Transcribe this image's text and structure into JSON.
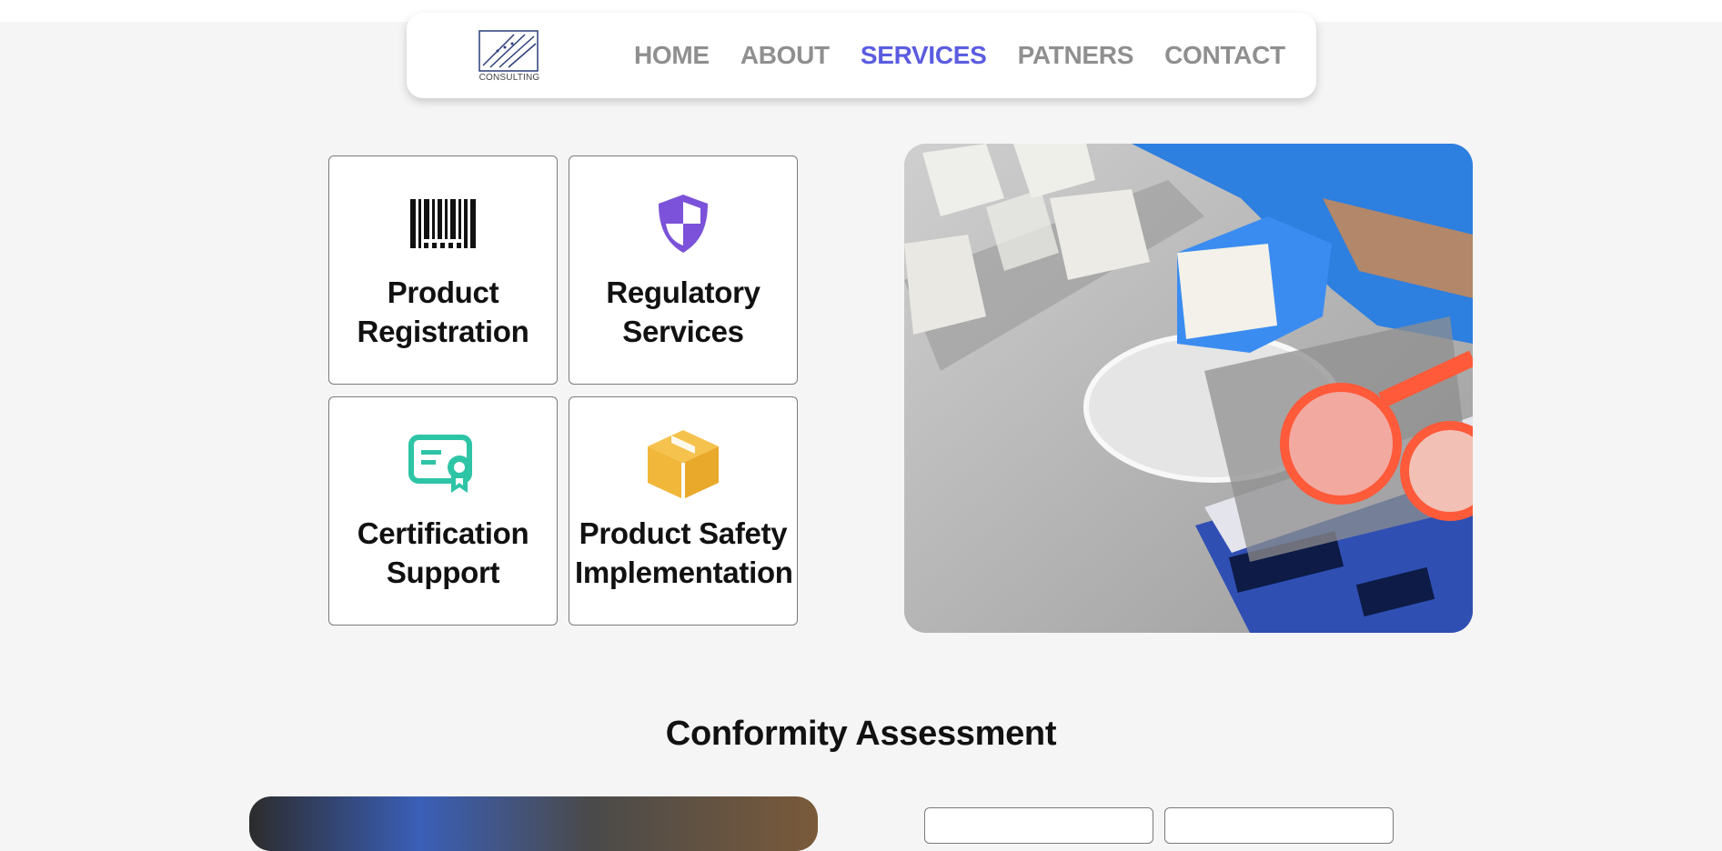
{
  "logo": {
    "text": "CONSULTING"
  },
  "nav": {
    "items": [
      {
        "label": "HOME",
        "active": false
      },
      {
        "label": "ABOUT",
        "active": false
      },
      {
        "label": "SERVICES",
        "active": true
      },
      {
        "label": "PATNERS",
        "active": false
      },
      {
        "label": "CONTACT",
        "active": false
      }
    ],
    "active_color": "#5b5ce0",
    "inactive_color": "#8f8f8f"
  },
  "services": [
    {
      "label_line1": "Product",
      "label_line2": "Registration",
      "icon": "barcode-icon",
      "icon_color": "#111111"
    },
    {
      "label_line1": "Regulatory",
      "label_line2": "Services",
      "icon": "shield-icon",
      "icon_color": "#7b52d9"
    },
    {
      "label_line1": "Certification",
      "label_line2": "Support",
      "icon": "certificate-icon",
      "icon_color": "#2ec4a6"
    },
    {
      "label_line1": "Product Safety",
      "label_line2": "Implementation",
      "icon": "box-icon",
      "icon_color": "#f1b73a"
    }
  ],
  "section": {
    "title": "Conformity Assessment"
  }
}
